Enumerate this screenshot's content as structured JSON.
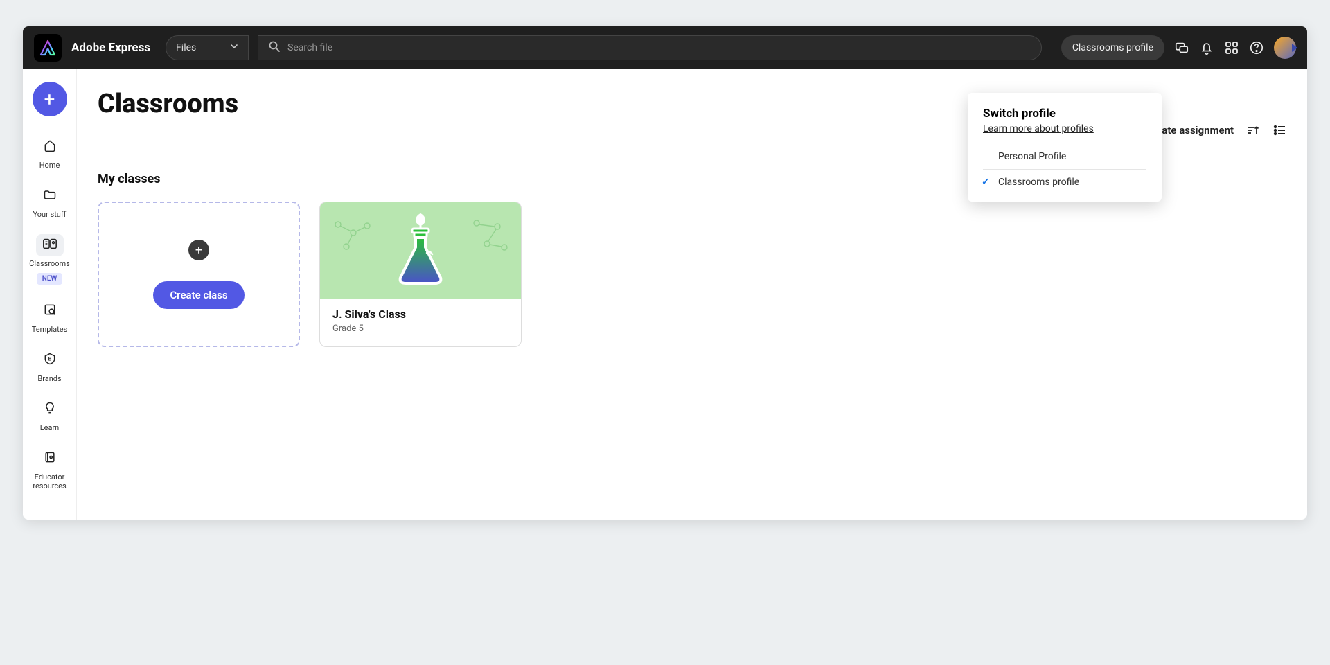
{
  "brand": "Adobe Express",
  "topbar": {
    "filesLabel": "Files",
    "searchPlaceholder": "Search file",
    "profileButton": "Classrooms profile"
  },
  "sidebar": {
    "items": [
      {
        "label": "Home"
      },
      {
        "label": "Your stuff"
      },
      {
        "label": "Classrooms",
        "badge": "NEW"
      },
      {
        "label": "Templates"
      },
      {
        "label": "Brands"
      },
      {
        "label": "Learn"
      },
      {
        "label": "Educator resources"
      }
    ]
  },
  "page": {
    "title": "Classrooms",
    "createAssignment": "Create assignment",
    "sectionTitle": "My classes",
    "createClassLabel": "Create class"
  },
  "classes": [
    {
      "name": "J. Silva's Class",
      "grade": "Grade 5"
    }
  ],
  "profilePopover": {
    "title": "Switch profile",
    "learnMore": "Learn more about profiles",
    "options": [
      {
        "label": "Personal Profile",
        "selected": false
      },
      {
        "label": "Classrooms profile",
        "selected": true
      }
    ]
  }
}
